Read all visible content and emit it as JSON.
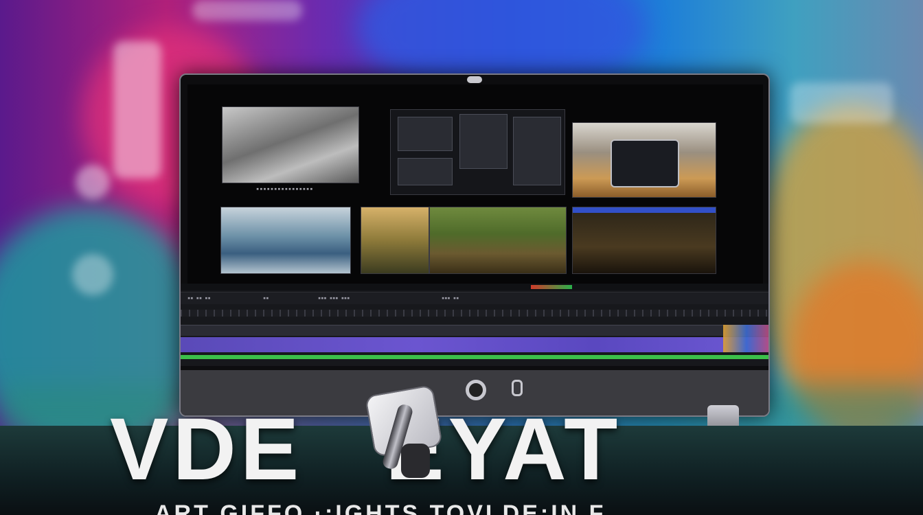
{
  "hero": {
    "title_left": "VDE",
    "title_right": "EYAT",
    "subtitle": "ART GIFFO  ·:IGHTS TOVLDE:IN F"
  },
  "icons": [
    "power-icon",
    "camera-icon",
    "webcam-icon"
  ],
  "colors": {
    "timeline_violet": "#6b55d0",
    "timeline_green": "#3cc04a",
    "monitor_bezel": "#0d0d0f"
  }
}
